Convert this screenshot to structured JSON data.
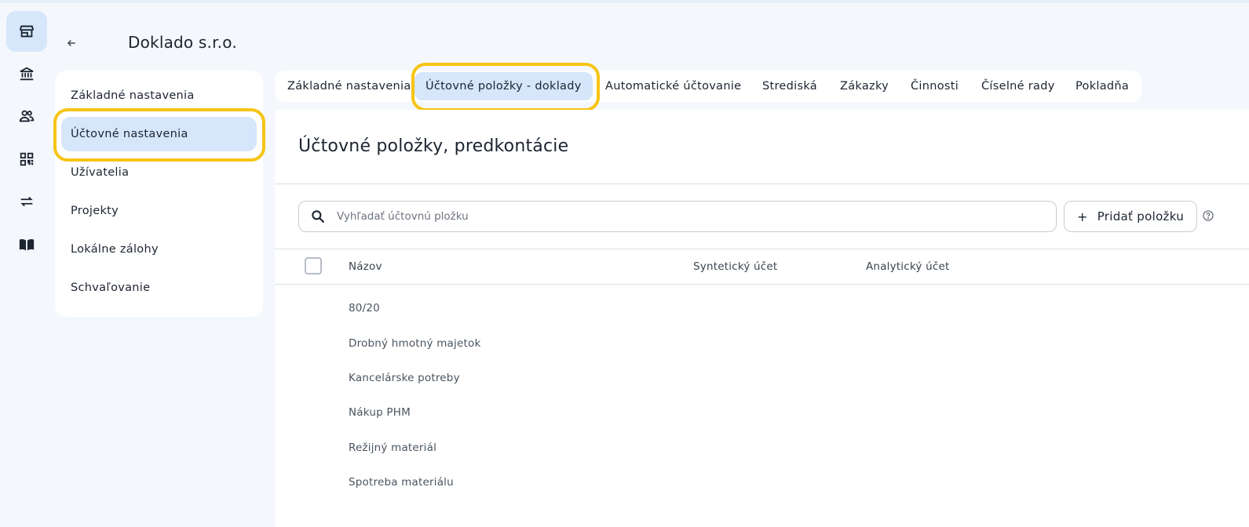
{
  "app": {
    "company_title": "Doklado s.r.o."
  },
  "rail": {
    "icons": [
      "store-icon",
      "bank-icon",
      "people-icon",
      "qr-code-icon",
      "transfer-icon",
      "book-icon"
    ]
  },
  "settings_menu": {
    "items": [
      {
        "label": "Základné nastavenia"
      },
      {
        "label": "Účtovné nastavenia",
        "active": true
      },
      {
        "label": "Užívatelia"
      },
      {
        "label": "Projekty"
      },
      {
        "label": "Lokálne zálohy"
      },
      {
        "label": "Schvaľovanie"
      }
    ]
  },
  "tabs": [
    {
      "label": "Základné nastavenia"
    },
    {
      "label": "Účtovné položky - doklady",
      "active": true
    },
    {
      "label": "Automatické účtovanie"
    },
    {
      "label": "Strediská"
    },
    {
      "label": "Zákazky"
    },
    {
      "label": "Činnosti"
    },
    {
      "label": "Číselné rady"
    },
    {
      "label": "Pokladňa"
    }
  ],
  "main": {
    "heading": "Účtovné položky, predkontácie",
    "search": {
      "placeholder": "Vyhľadať účtovnú pložku",
      "value": ""
    },
    "add_button": {
      "label": "Pridať položku"
    },
    "table": {
      "columns": [
        "Názov",
        "Syntetický účet",
        "Analytický účet"
      ],
      "rows": [
        {
          "name": "80/20"
        },
        {
          "name": "Drobný hmotný majetok"
        },
        {
          "name": "Kancelárske potreby"
        },
        {
          "name": "Nákup PHM"
        },
        {
          "name": "Režijný materiál"
        },
        {
          "name": "Spotreba materiálu"
        }
      ]
    }
  },
  "colors": {
    "accent": "#d6e6fb",
    "highlight": "#f7c415",
    "background": "#f4f8fc"
  }
}
